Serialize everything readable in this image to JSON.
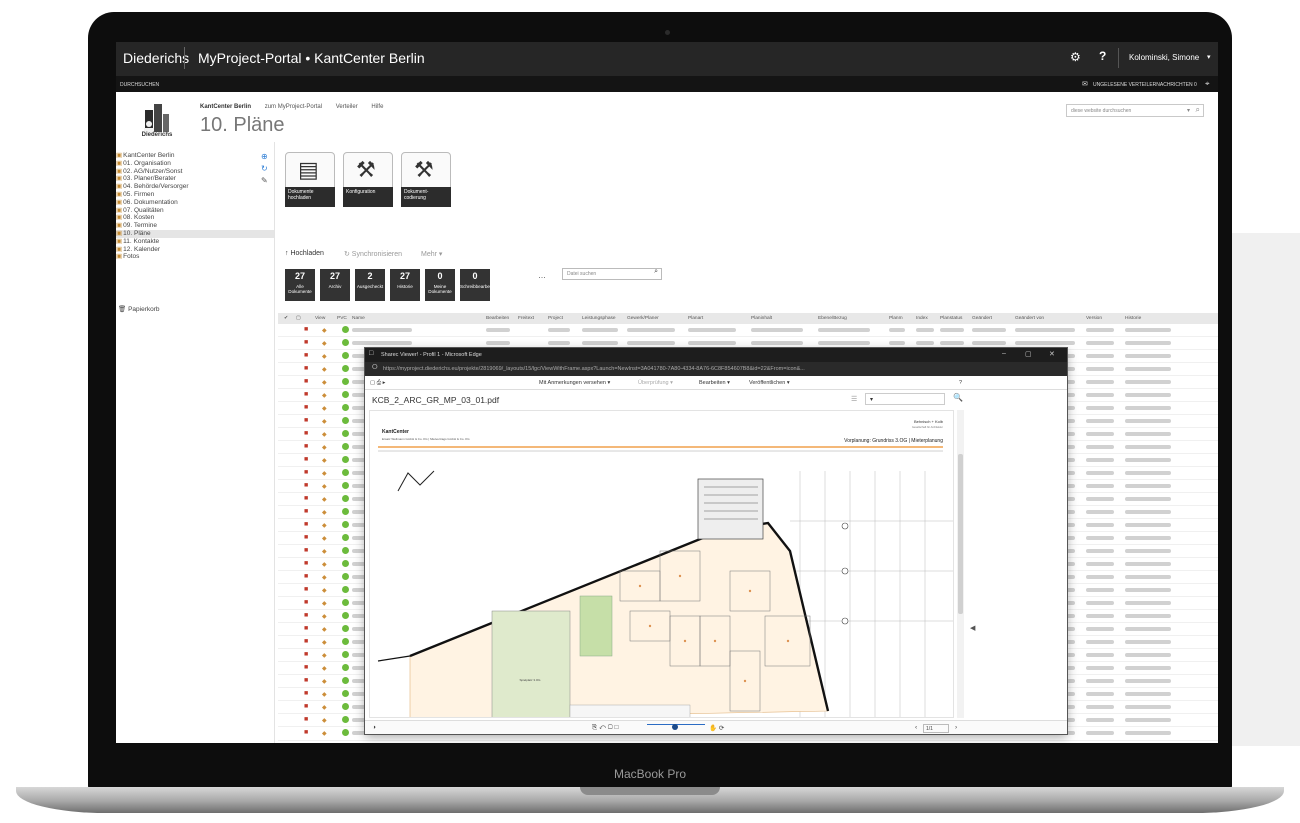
{
  "device": {
    "label": "MacBook Pro"
  },
  "topbar": {
    "brand": "Diederichs",
    "site_title": "MyProject-Portal • KantCenter Berlin",
    "settings_icon": "⚙",
    "help_label": "?",
    "user_name": "Kolominski, Simone",
    "user_menu_icon": "▾"
  },
  "subbar": {
    "browse": "DURCHSUCHEN",
    "unread": "UNGELESENE VERTEILERNACHRICHTEN 0",
    "mail_icon": "✉",
    "focus_icon": "⌖"
  },
  "logo": {
    "caption": "Diederichs"
  },
  "breadcrumb": {
    "site": "KantCenter Berlin",
    "links": [
      "zum MyProject-Portal",
      "Verteiler",
      "Hilfe"
    ]
  },
  "page_title": "10. Pläne",
  "site_search": {
    "placeholder": "diese website durchsuchen",
    "arrow": "▾",
    "glass": "⌕"
  },
  "nav_tree": [
    {
      "label": "KantCenter Berlin",
      "selected": false
    },
    {
      "label": "01. Organisation",
      "selected": false
    },
    {
      "label": "02. AG/Nutzer/Sonst",
      "selected": false
    },
    {
      "label": "03. Planer/Berater",
      "selected": false
    },
    {
      "label": "04. Behörde/Versorger",
      "selected": false
    },
    {
      "label": "05. Firmen",
      "selected": false
    },
    {
      "label": "06. Dokumentation",
      "selected": false
    },
    {
      "label": "07. Qualitäten",
      "selected": false
    },
    {
      "label": "08. Kosten",
      "selected": false
    },
    {
      "label": "09. Termine",
      "selected": false
    },
    {
      "label": "10. Pläne",
      "selected": true
    },
    {
      "label": "11. Kontakte",
      "selected": false
    },
    {
      "label": "12. Kalender",
      "selected": false
    },
    {
      "label": "Fotos",
      "selected": false
    }
  ],
  "nav_icons": {
    "add": "⊕",
    "sync": "↻",
    "edit": "✎"
  },
  "trash": {
    "icon": "🗑",
    "label": "Papierkorb"
  },
  "tiles": [
    {
      "label": "Dokumente hochladen",
      "icon": "▤"
    },
    {
      "label": "Konfiguration",
      "icon": "⚒"
    },
    {
      "label": "Dokument-codierung",
      "icon": "⚒"
    }
  ],
  "toolbar": {
    "upload": "↑ Hochladen",
    "sync": "↻ Synchronisieren",
    "more": "Mehr ▾"
  },
  "counters": [
    {
      "count": "27",
      "label": "Alle Dokumente"
    },
    {
      "count": "27",
      "label": "Archiv"
    },
    {
      "count": "2",
      "label": "Ausgecheckt"
    },
    {
      "count": "27",
      "label": "Historie"
    },
    {
      "count": "0",
      "label": "Meine Dokumente"
    },
    {
      "count": "0",
      "label": "Schreibbearbe"
    }
  ],
  "counter_more": "…",
  "file_search": {
    "placeholder": "Datei suchen",
    "glass": "⌕"
  },
  "grid": {
    "headers": [
      "✔",
      "▢",
      "View",
      "PVC",
      "Name",
      "Bearbeiten",
      "Freitext",
      "Project",
      "Leistungsphase",
      "Gewerk/Planer",
      "Planart",
      "Planinhalt",
      "Ebene/Bezug",
      "Planm",
      "Index",
      "Planstatus",
      "Geändert",
      "Geändert von",
      "Version",
      "Historie"
    ]
  },
  "viewer": {
    "window_title": "Sharec Viewer! - Profil 1 - Microsoft Edge",
    "url": "https://myproject.diederichs.eu/projekte/2819069/_layouts/15/lgc/ViewWithFrame.aspx?Launch=NewInst=3A041780-7A80-4334-8A76-6C8F854607B8&id=22&From=icon&...",
    "controls": {
      "minimize": "–",
      "maximize": "▢",
      "close": "✕",
      "lock": "⭘"
    },
    "toolbar": {
      "tool_icons": "▢ ⎙ ▸",
      "annotate": "Mit Anmerkungen versehen ▾",
      "compare": "Überprüfung ▾",
      "edit": "Bearbeiten ▾",
      "publish": "Veröffentlichen ▾",
      "help": "?"
    },
    "filename": "KCB_2_ARC_GR_MP_03_01.pdf",
    "page_select_icon": "☰",
    "page_select_arrow": "▾",
    "zoom_icon": "🔍",
    "collapse_arrow": "◀",
    "plan_header": {
      "client": "KantCenter",
      "client_sub": "Ersatz Wellmann GmbH & Co. KG | Mietvertrags GmbH & Co. KG",
      "title": "Vorplanung: Grundriss 3.OG | Mieterplanung",
      "architect": "Behnisch + Kolb",
      "architect_sub": "Gesellschaft für Architektur",
      "room_label": "Spielplatz 3.OG"
    },
    "bottom": {
      "contrast": "◑",
      "tools": "⎘ ↶ ▢ □",
      "hand_icons": "✋ ⟳",
      "prev": "‹",
      "page": "1/1",
      "next": "›"
    }
  }
}
